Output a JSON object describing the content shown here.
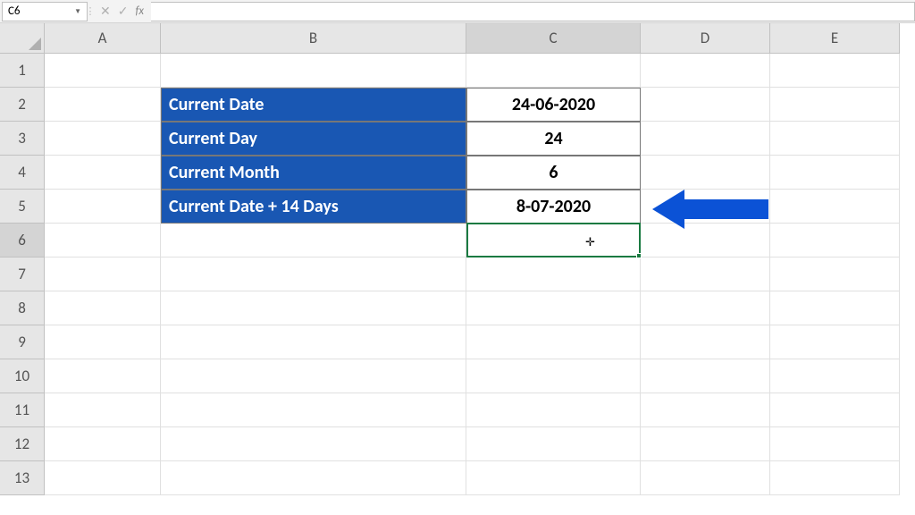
{
  "name_box": "C6",
  "formula_input": "",
  "columns": [
    "A",
    "B",
    "C",
    "D",
    "E"
  ],
  "rows": [
    "1",
    "2",
    "3",
    "4",
    "5",
    "6",
    "7",
    "8",
    "9",
    "10",
    "11",
    "12",
    "13"
  ],
  "selected_column": "C",
  "selected_row": "6",
  "data": {
    "B2": "Current Date",
    "C2": "24-06-2020",
    "B3": "Current Day",
    "C3": "24",
    "B4": "Current Month",
    "C4": "6",
    "B5": "Current Date + 14 Days",
    "C5": "8-07-2020"
  },
  "fx_label": "fx"
}
